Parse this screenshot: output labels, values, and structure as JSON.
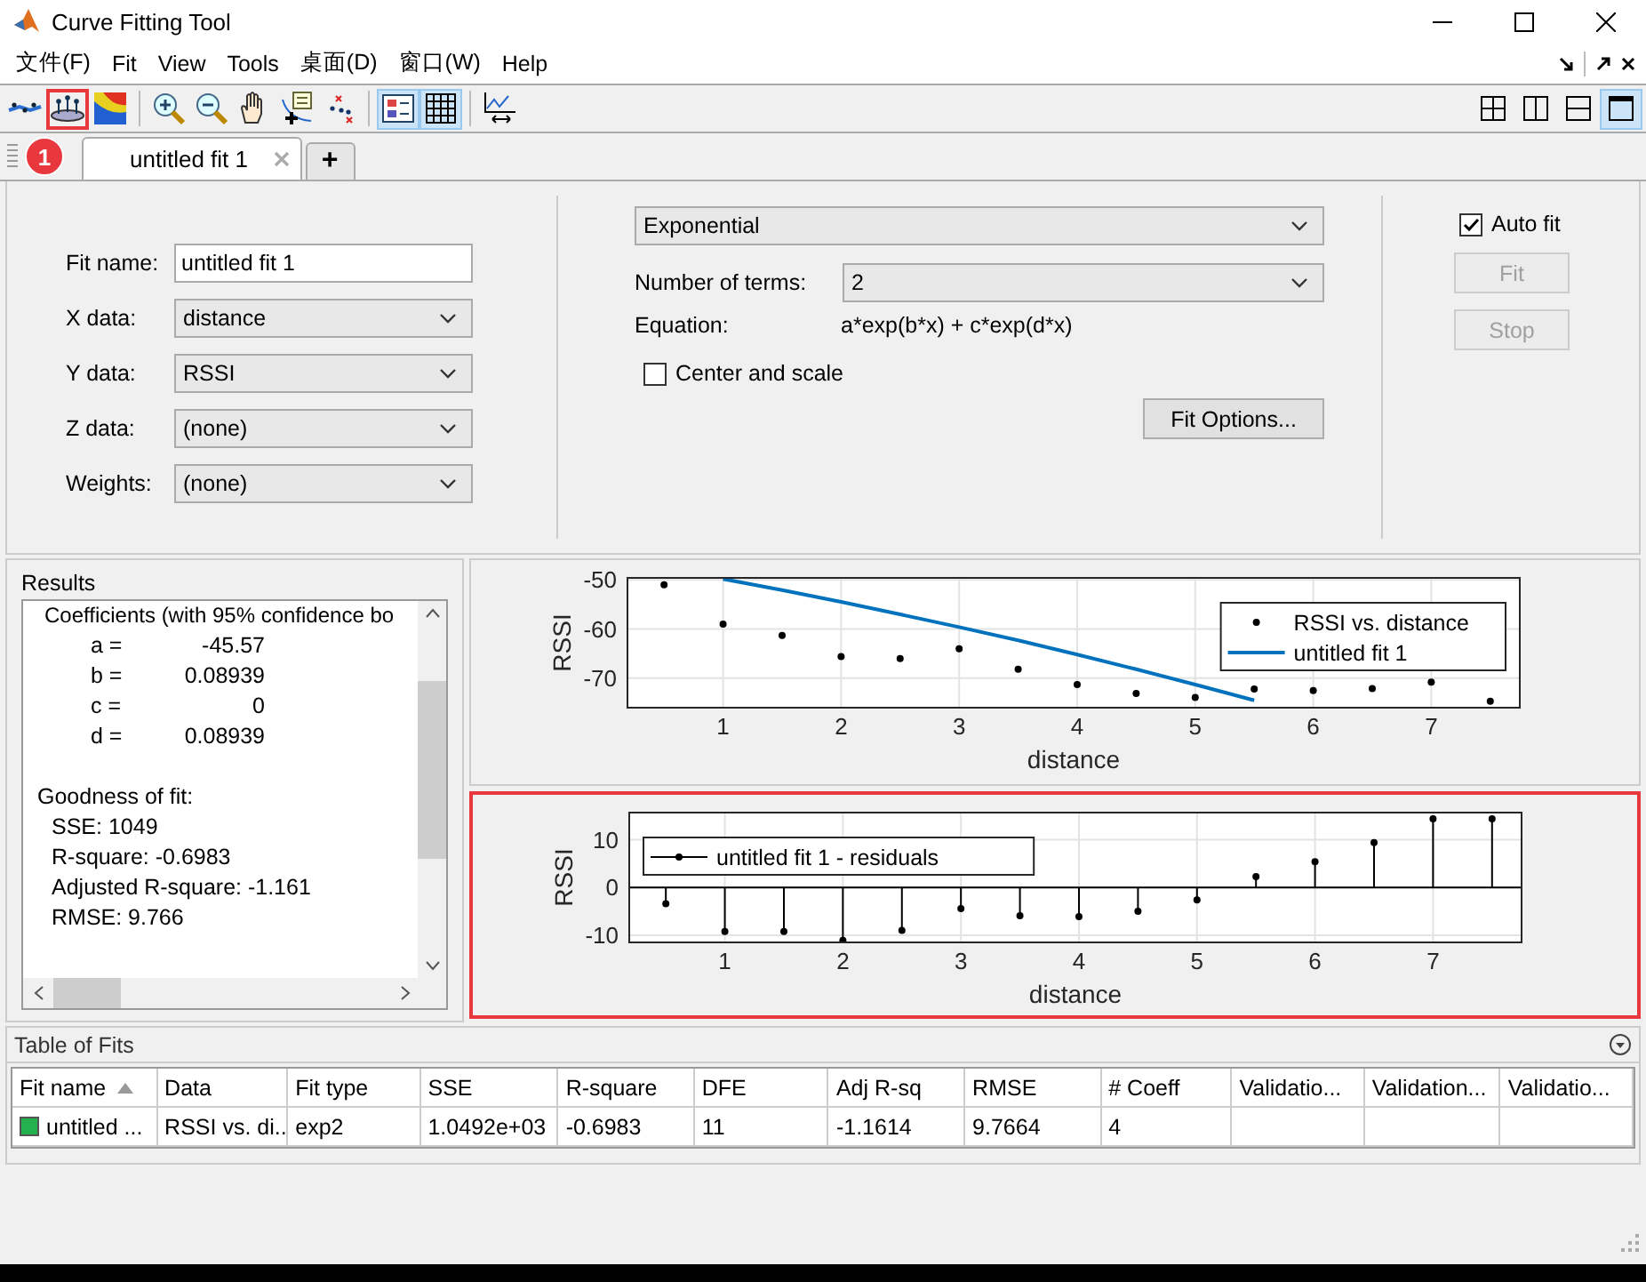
{
  "window": {
    "title": "Curve Fitting Tool"
  },
  "menu": [
    "文件(F)",
    "Fit",
    "View",
    "Tools",
    "桌面(D)",
    "窗口(W)",
    "Help"
  ],
  "toolbar": {
    "groups": [
      [
        {
          "kind": "curve",
          "selected": false,
          "highlighted": false
        },
        {
          "kind": "surface",
          "selected": false,
          "highlighted": true
        },
        {
          "kind": "colormap",
          "selected": false,
          "highlighted": false
        }
      ],
      [
        {
          "kind": "zoom-in",
          "selected": false,
          "highlighted": false
        },
        {
          "kind": "zoom-out",
          "selected": false,
          "highlighted": false
        },
        {
          "kind": "pan",
          "selected": false,
          "highlighted": false
        },
        {
          "kind": "cursor",
          "selected": false,
          "highlighted": false
        },
        {
          "kind": "exclude",
          "selected": false,
          "highlighted": false
        }
      ],
      [
        {
          "kind": "legend",
          "selected": true,
          "highlighted": false
        },
        {
          "kind": "grid",
          "selected": true,
          "highlighted": false
        }
      ],
      [
        {
          "kind": "limits",
          "selected": false,
          "highlighted": false
        }
      ]
    ],
    "layouts": [
      {
        "kind": "quad",
        "selected": false
      },
      {
        "kind": "cols",
        "selected": false
      },
      {
        "kind": "rows",
        "selected": false
      },
      {
        "kind": "single",
        "selected": true
      }
    ]
  },
  "annotation": {
    "badge": "1"
  },
  "tabs": [
    {
      "label": "untitled fit 1",
      "selected": true
    }
  ],
  "add_tab": "+",
  "fit_form": {
    "fit_name": {
      "label": "Fit name:",
      "value": "untitled fit 1"
    },
    "fields": [
      {
        "label": "X data:",
        "value": "distance"
      },
      {
        "label": "Y data:",
        "value": "RSSI"
      },
      {
        "label": "Z data:",
        "value": "(none)"
      },
      {
        "label": "Weights:",
        "value": "(none)"
      }
    ]
  },
  "fit_type": {
    "value": "Exponential"
  },
  "terms": {
    "label": "Number of terms:",
    "value": "2"
  },
  "equation": {
    "label": "Equation:",
    "value": "a*exp(b*x) + c*exp(d*x)"
  },
  "center_scale": {
    "label": "Center and scale",
    "checked": false
  },
  "fit_options_button": "Fit Options...",
  "auto_fit": {
    "label": "Auto fit",
    "checked": true
  },
  "fit_button": {
    "label": "Fit",
    "disabled": true
  },
  "stop_button": {
    "label": "Stop",
    "disabled": true
  },
  "results": {
    "title": "Results",
    "coefficients_heading": "Coefficients (with 95% confidence bo",
    "coefficients": [
      {
        "name": "a =",
        "value": "-45.57"
      },
      {
        "name": "b =",
        "value": "0.08939"
      },
      {
        "name": "c =",
        "value": "0"
      },
      {
        "name": "d =",
        "value": "0.08939"
      }
    ],
    "goodness_heading": "Goodness of fit:",
    "stats": [
      "SSE: 1049",
      "R-square: -0.6983",
      "Adjusted R-square: -1.161",
      "RMSE: 9.766"
    ]
  },
  "plots": [
    {
      "highlighted": false,
      "chart_data": {
        "type": "scatter",
        "xlabel": "distance",
        "ylabel": "RSSI",
        "x": [
          0.5,
          1,
          1.5,
          2,
          2.5,
          3,
          3.5,
          4,
          4.5,
          5,
          5.5,
          6,
          6.5,
          7,
          7.5
        ],
        "xlim": [
          0.19,
          7.75
        ],
        "ylim": [
          -76,
          -49.6
        ],
        "xticks": [
          1,
          2,
          3,
          4,
          5,
          6,
          7
        ],
        "yticks": [
          -50,
          -60,
          -70
        ],
        "grid": true,
        "legend": true,
        "series": [
          {
            "name": "RSSI vs. distance",
            "type": "scatter",
            "color": "#000000",
            "values": [
              -51,
              -59,
              -61.3,
              -65.6,
              -66,
              -64,
              -68.2,
              -71.3,
              -73.1,
              -73.9,
              -72.2,
              -72.5,
              -72.1,
              -70.8,
              -74.7
            ]
          },
          {
            "name": "untitled fit 1",
            "type": "line",
            "color": "#0072bd",
            "values": [
              null,
              -49.8,
              -52.1,
              -54.5,
              -57,
              -59.6,
              -62.3,
              -65.2,
              -68.2,
              -71.3,
              -74.5,
              null,
              null,
              null,
              null
            ]
          }
        ]
      }
    },
    {
      "highlighted": true,
      "chart_data": {
        "type": "lollipop",
        "xlabel": "distance",
        "ylabel": "RSSI",
        "x": [
          0.5,
          1,
          1.5,
          2,
          2.5,
          3,
          3.5,
          4,
          4.5,
          5,
          5.5,
          6,
          6.5,
          7,
          7.5
        ],
        "xlim": [
          0.19,
          7.75
        ],
        "ylim": [
          -11.5,
          15.7
        ],
        "xticks": [
          1,
          2,
          3,
          4,
          5,
          6,
          7
        ],
        "yticks": [
          -10,
          0,
          10
        ],
        "grid": true,
        "legend": true,
        "series": [
          {
            "name": "untitled fit 1 - residuals",
            "color": "#000000",
            "values": [
              -3.4,
              -9.2,
              -9.2,
              -11.1,
              -9,
              -4.4,
              -5.9,
              -6.1,
              -5,
              -2.6,
              2.3,
              5.4,
              9.4,
              14.4,
              14.4
            ]
          }
        ]
      }
    }
  ],
  "table_of_fits": {
    "title": "Table of Fits",
    "columns": [
      {
        "label": "Fit name",
        "sorted": true
      },
      {
        "label": "Data",
        "sorted": false
      },
      {
        "label": "Fit type",
        "sorted": false
      },
      {
        "label": "SSE",
        "sorted": false
      },
      {
        "label": "R-square",
        "sorted": false
      },
      {
        "label": "DFE",
        "sorted": false
      },
      {
        "label": "Adj R-sq",
        "sorted": false
      },
      {
        "label": "RMSE",
        "sorted": false
      },
      {
        "label": "# Coeff",
        "sorted": false
      },
      {
        "label": "Validatio...",
        "sorted": false
      },
      {
        "label": "Validation...",
        "sorted": false
      },
      {
        "label": "Validatio...",
        "sorted": false
      }
    ],
    "rows": [
      {
        "color": "#22b14c",
        "cells": [
          "untitled ...",
          "RSSI vs. di...",
          "exp2",
          "1.0492e+03",
          "-0.6983",
          "11",
          "-1.1614",
          "9.7664",
          "4",
          "",
          "",
          ""
        ]
      }
    ]
  }
}
